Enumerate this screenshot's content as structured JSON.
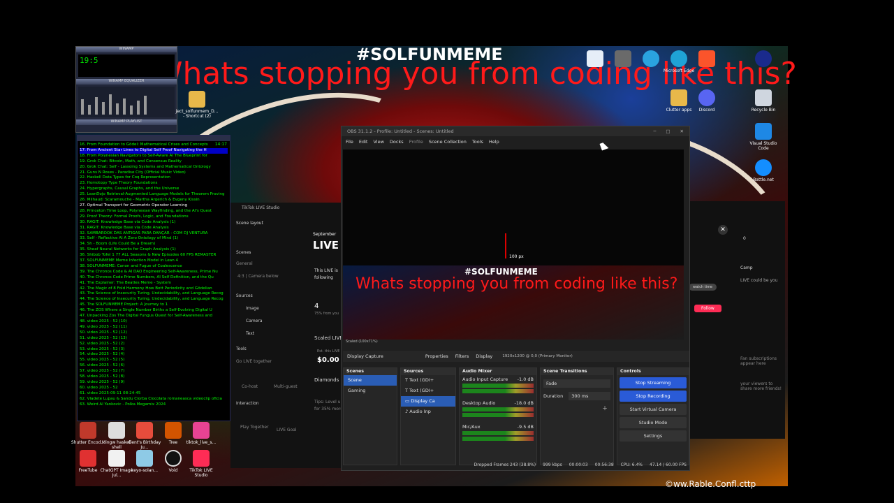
{
  "overlay": {
    "hashtag": "#SOLFUNMEME",
    "banner": "Whats stopping you from coding like this?",
    "watermark": "©ww.Rable.Confl.cttp"
  },
  "desktop_icons": [
    {
      "label": "Clutter apps"
    },
    {
      "label": "Discord"
    },
    {
      "label": "Recycle Bin"
    },
    {
      "label": "Visual Studio Code"
    },
    {
      "label": "Battle.net"
    },
    {
      "label": "Microsoft Edge"
    },
    {
      "label": "Shutter Encod..."
    },
    {
      "label": "Mingw haskell shell"
    },
    {
      "label": "Gent's Birthday Ju..."
    },
    {
      "label": "Tree"
    },
    {
      "label": "tiktok_live_s..."
    },
    {
      "label": "FreeTube"
    },
    {
      "label": "ChatGPT Image Jul..."
    },
    {
      "label": "keyo-solan..."
    },
    {
      "label": "Void"
    },
    {
      "label": "TikTok LIVE Studio"
    }
  ],
  "winamp": {
    "title": "WINAMP",
    "time": "19:5",
    "eq_title": "WINAMP EQUALIZER",
    "playlist_title": "WINAMP PLAYLIST",
    "shortcut": "ject_solfunmem_D... - Shortcut (2)"
  },
  "playlist": {
    "time": "14:17",
    "items": [
      "16. From Foundation to Gödel: Mathematical Crises and Concepts",
      "17. From Ancient Star Lines to Digital Self Proof Navigating the H",
      "18. From Polynesian Navigators to Self-Aware AI The Blueprint for",
      "19. Grok Chat: Bitcoin, Math, and Consensus Reality",
      "20. Grok Chat: Self - Lassoing Systems and Mathematical Ontology",
      "21. Guns N Roses - Paradise City (Official Music Video)",
      "22. Haskell Data Types for Coq Representation",
      "23. Homotopy Type Theory Foundations",
      "24. Hypergraphs, Causal Graphs, and the Universe",
      "25. LeanDojo Retrieval-Augmented Language Models for Theorem Proving",
      "26. Milhaud: Scaramouche - Martha Argerich & Evgeny Kissin",
      "27. Optimal Transport for Geometric Operator Learning",
      "28. Princeton Time Loop, Polynesian Wayfinding, and the AI's Quest",
      "29. Proof Theory: Formal Proofs, Logic, and Foundations",
      "30. RAGIT: Knowledge Base via Code Analysis (1)",
      "31. RAGIT: Knowledge Base via Code Analysis",
      "32. SAMBAROOK DAS ANTIGAS PARA DANÇAR - COM DJ VENTURA",
      "33. Self - Reflective AI A Zero Ontology of Mind (1)",
      "34. Sh - Boom (Life Could Be a Dream)",
      "35. Sheaf Neural Networks for Graph Analysis (1)",
      "36. Shibob Tofel 1 77 ALL Seasons & New Episodes 60 FPS REMASTER",
      "37. SOLFUNMEME Meme Infection Model in Lean 4",
      "38. SOLFUNMEME: Canon and Fugue of Coalescence",
      "39. The Chronos Code & AI DAO Engineering Self-Awareness, Prime Nu",
      "40. The Chronos Code Prime Numbers, AI Self Definition, and the Qu",
      "41. The Explainer: The Beatles Meme - System",
      "42. The Magic of 8 Fold Harmony How Bott Periodicity and Gödelian",
      "43. The Science of Insecurity Turing, Undecidability, and Language Recog",
      "44. The Science of Insecurity Turing, Undecidability, and Language Recog",
      "45. The SOLFUNMEME Project: A Journey to 1",
      "46. The ZOS Where a Single Number Births a Self-Evolving Digital U",
      "47. Unpacking Zos The Digital Fungus Quest for Self-Awareness and",
      "48. video 2025 - 52 (10)",
      "49. video 2025 - 52 (11)",
      "50. video 2025 - 52 (12)",
      "51. video 2025 - 52 (13)",
      "52. video 2025 - 52 (2)",
      "53. video 2025 - 52 (3)",
      "54. video 2025 - 52 (4)",
      "55. video 2025 - 52 (5)",
      "56. video 2025 - 52 (6)",
      "57. video 2025 - 52 (7)",
      "58. video 2025 - 52 (8)",
      "59. video 2025 - 52 (9)",
      "60. video 2025 - 52",
      "61. video 2025-09-11 08-24-45",
      "62. Vladete Lupau & Sandu Ciorba Ciocolata romaneasca videoclip oficia",
      "63. Weird Al Yankovic - Polka Megamix 2024"
    ]
  },
  "tiktok": {
    "title": "TikTok LIVE Studio",
    "scene_layout": "Scene layout",
    "scenes": "Scenes",
    "general": "General",
    "camera_below": "4:3 | Camera below",
    "sources": "Sources",
    "image": "Image",
    "camera": "Camera",
    "text": "Text",
    "tools": "Tools",
    "go_live_together": "Go LIVE together",
    "co_host": "Co-host",
    "multi_guest": "Multi-guest",
    "interaction": "Interaction",
    "play_together": "Play Together",
    "live_goal": "LIVE Goal",
    "september": "September",
    "live": "LIVE",
    "this_live_is": "This LIVE is",
    "following": "following",
    "count": "4",
    "pct": "75% from you",
    "scaled_live": "Scaled LIVE",
    "est": "Est. this LIVE",
    "money": "$0.00",
    "diamonds": "Diamonds",
    "tips": "Tips: Level up",
    "tips2": "for 35% more",
    "follow": "Follow",
    "camp": "Camp",
    "watch_time": "watch time",
    "side1": "LIVE could be you",
    "side2": "Fan subscriptions appear here",
    "side3": "your viewers to share more friends!",
    "counter": "0"
  },
  "obs": {
    "title": "OBS 31.1.2 - Profile: Untitled - Scenes: Untitled",
    "menu": [
      "File",
      "Edit",
      "View",
      "Docks",
      "Profile",
      "Scene Collection",
      "Tools",
      "Help"
    ],
    "preview_label": "100 px",
    "mini_status": "Scaled (100x71%)",
    "toolbar": {
      "display_capture": "Display Capture",
      "properties": "Properties",
      "filters": "Filters",
      "display": "Display",
      "monitor": "1920x1200 @ 0,0 (Primary Monitor)"
    },
    "scenes": {
      "title": "Scenes",
      "items": [
        "Scene",
        "Gaming"
      ]
    },
    "sources": {
      "title": "Sources",
      "items": [
        "Text (GDI+",
        "Text (GDI+",
        "Display Ca",
        "Audio Inp"
      ]
    },
    "mixer": {
      "title": "Audio Mixer",
      "channels": [
        {
          "name": "Audio Input Capture",
          "db": "-1.0 dB"
        },
        {
          "name": "Desktop Audio",
          "db": "-18.0 dB"
        },
        {
          "name": "Mic/Aux",
          "db": "-9.5 dB"
        }
      ]
    },
    "transitions": {
      "title": "Scene Transitions",
      "type": "Fade",
      "duration_label": "Duration",
      "duration": "300 ms"
    },
    "controls": {
      "title": "Controls",
      "buttons": [
        "Stop Streaming",
        "Stop Recording",
        "Start Virtual Camera",
        "Studio Mode",
        "Settings"
      ]
    },
    "status": {
      "dropped": "Dropped Frames 243 (38.8%)",
      "kbps": "999 kbps",
      "live_time": "00:00:03",
      "rec_time": "00:56:38",
      "cpu": "CPU: 6.4%",
      "fps": "47.14 / 60.00 FPS"
    }
  },
  "colors": {
    "banner": "#ff1a1a",
    "stream_active": "#2a5bd7",
    "selection": "#2a5db5",
    "playlist_green": "#00ff00",
    "tiktok_follow": "#fe2c55"
  }
}
